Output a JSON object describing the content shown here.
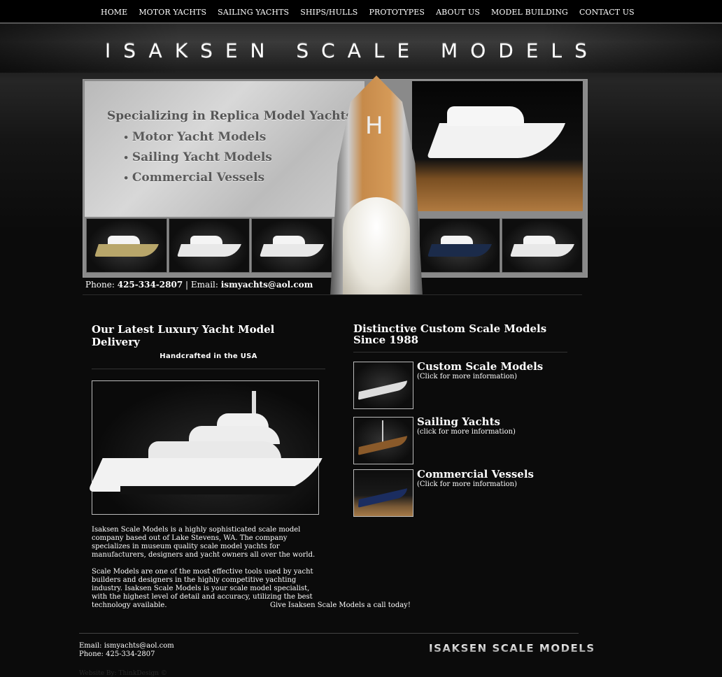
{
  "nav": {
    "items": [
      {
        "label": "HOME"
      },
      {
        "label": "MOTOR YACHTS"
      },
      {
        "label": "SAILING YACHTS"
      },
      {
        "label": "SHIPS/HULLS"
      },
      {
        "label": "PROTOTYPES"
      },
      {
        "label": "ABOUT US"
      },
      {
        "label": "MODEL BUILDING"
      },
      {
        "label": "CONTACT US"
      }
    ]
  },
  "header": {
    "logo": "ISAKSEN SCALE MODELS"
  },
  "hero": {
    "headline": "Specializing in Replica Model Yachts",
    "bullets": [
      "Motor Yacht Models",
      "Sailing Yacht Models",
      "Commercial Vessels"
    ],
    "bow_letter": "H"
  },
  "contact": {
    "phone_label": "Phone:",
    "phone": "425-334-2807",
    "sep": "|",
    "email_label": "Email:",
    "email": "ismyachts@aol.com"
  },
  "left": {
    "title": "Our Latest Luxury Yacht Model Delivery",
    "subtitle": "Handcrafted in the USA",
    "para1": "Isaksen Scale Models is a highly sophisticated scale model company based out of Lake Stevens, WA. The company specializes in museum quality scale model yachts for manufacturers, designers and yacht owners all over the world.",
    "para2": "Scale Models are one of  the most effective tools used by yacht builders and designers in the highly competitive yachting industry. Isaksen Scale Models is your scale model specialist, with the highest level of detail and accuracy, utilizing the best technology available.",
    "call": "Give Isaksen Scale Models a call today!"
  },
  "right": {
    "title": "Distinctive Custom Scale Models Since 1988",
    "items": [
      {
        "title": "Custom Scale Models",
        "note": "(Click for more information)"
      },
      {
        "title": "Sailing Yachts",
        "note": "(click for more information)"
      },
      {
        "title": "Commercial Vessels",
        "note": "(Click for more information)"
      }
    ]
  },
  "footer": {
    "email_line": "Email: ismyachts@aol.com",
    "phone_line": "Phone: 425-334-2807",
    "logo": "ISAKSEN SCALE MODELS",
    "faded": "Website By: ThinkDesign ©"
  }
}
